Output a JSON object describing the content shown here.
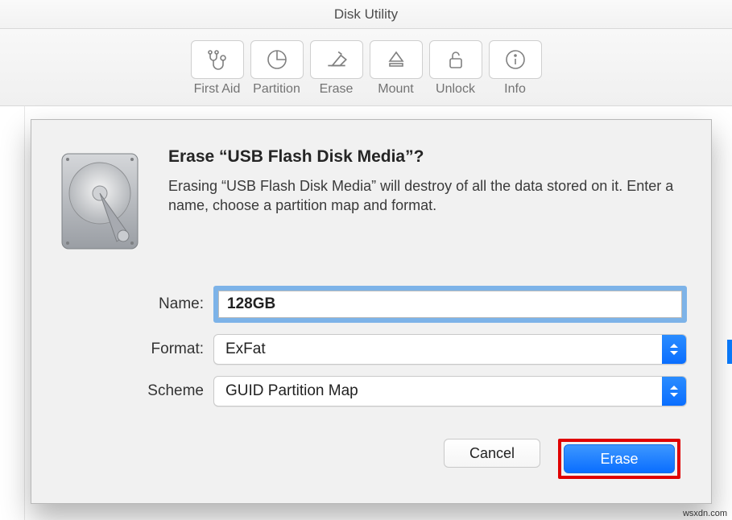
{
  "window": {
    "title": "Disk Utility"
  },
  "toolbar": {
    "first_aid": "First Aid",
    "partition": "Partition",
    "erase": "Erase",
    "mount": "Mount",
    "unlock": "Unlock",
    "info": "Info"
  },
  "sheet": {
    "title": "Erase “USB Flash Disk Media”?",
    "description": "Erasing “USB Flash Disk Media” will destroy of all the data stored on it. Enter a name, choose a partition map and format.",
    "labels": {
      "name": "Name:",
      "format": "Format:",
      "scheme": "Scheme"
    },
    "fields": {
      "name_value": "128GB",
      "format_value": "ExFat",
      "scheme_value": "GUID Partition Map"
    },
    "buttons": {
      "cancel": "Cancel",
      "erase": "Erase"
    }
  },
  "watermark": "wsxdn.com"
}
